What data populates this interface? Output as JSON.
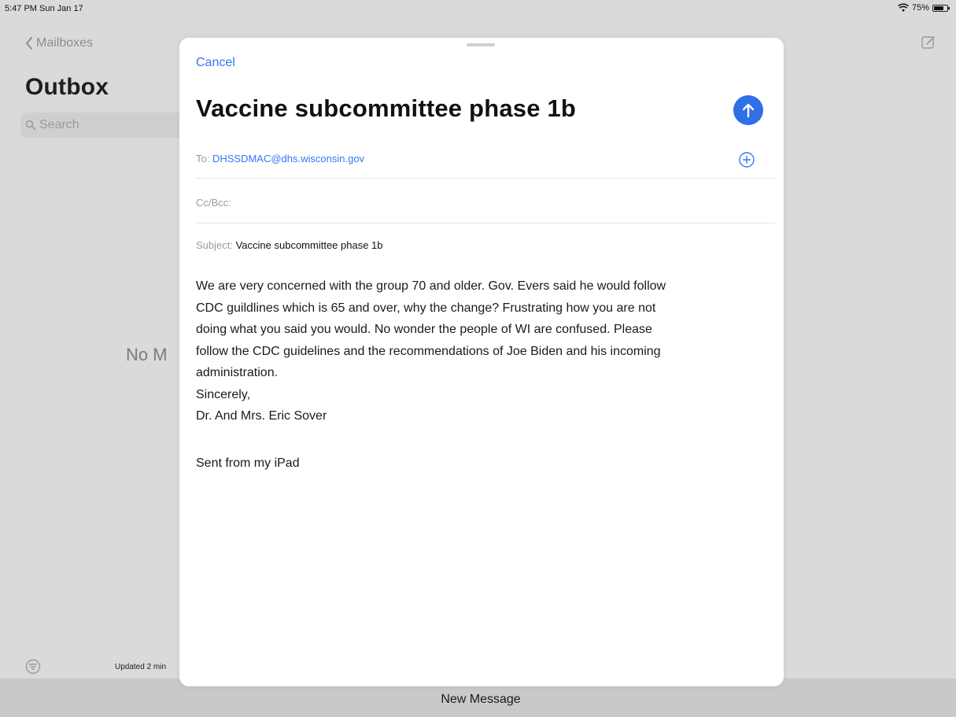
{
  "status_bar": {
    "time": "5:47 PM  Sun Jan 17",
    "battery": "75%",
    "battery_level": 0.75
  },
  "background": {
    "back_label": "Mailboxes",
    "title": "Outbox",
    "search_placeholder": "Search",
    "empty_text": "No M",
    "updated_text": "Updated 2 min"
  },
  "compose": {
    "cancel_label": "Cancel",
    "title": "Vaccine subcommittee phase 1b",
    "to_label": "To:",
    "to_value": "DHSSDMAC@dhs.wisconsin.gov",
    "cc_label": "Cc/Bcc:",
    "subject_label": "Subject:",
    "subject_value": "Vaccine subcommittee phase 1b",
    "body": "We are very concerned with the group 70 and older. Gov. Evers said he would follow\nCDC guildlines which is 65 and over, why the change? Frustrating how you are not\ndoing what you said you would. No wonder the people of WI are confused. Please\nfollow the CDC guidelines and the recommendations of Joe Biden and his incoming\nadministration.\nSincerely,\nDr. And Mrs. Eric Sover",
    "signature": "Sent from my iPad"
  },
  "bottom": {
    "label": "New Message"
  },
  "colors": {
    "accent": "#3478f6",
    "send_button": "#2f6fe8"
  },
  "icons": [
    "wifi-icon",
    "battery-icon",
    "chevron-left-icon",
    "search-icon",
    "compose-icon",
    "filter-icon",
    "arrow-up-icon",
    "plus-circle-icon"
  ]
}
